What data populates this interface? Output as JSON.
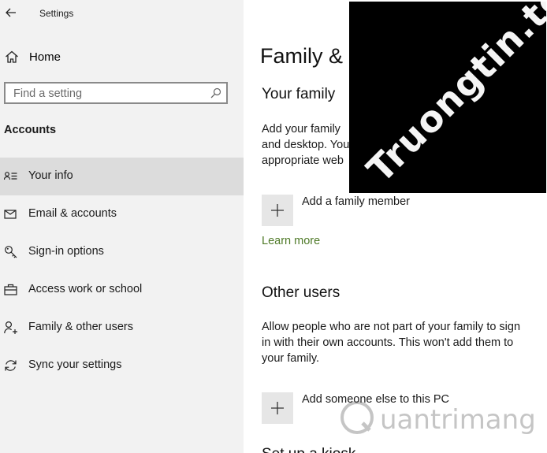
{
  "window": {
    "title": "Settings"
  },
  "sidebar": {
    "home_label": "Home",
    "search_placeholder": "Find a setting",
    "section_label": "Accounts",
    "items": [
      {
        "label": "Your info",
        "icon": "person-card-icon",
        "selected": true
      },
      {
        "label": "Email & accounts",
        "icon": "mail-icon",
        "selected": false
      },
      {
        "label": "Sign-in options",
        "icon": "key-icon",
        "selected": false
      },
      {
        "label": "Access work or school",
        "icon": "briefcase-icon",
        "selected": false
      },
      {
        "label": "Family & other users",
        "icon": "person-add-icon",
        "selected": false
      },
      {
        "label": "Sync your settings",
        "icon": "sync-icon",
        "selected": false
      }
    ]
  },
  "main": {
    "page_title": "Family & o",
    "your_family": {
      "heading": "Your family",
      "desc_line1": "Add your family",
      "desc_line2": "and desktop. You",
      "desc_line3": "appropriate web",
      "add_label": "Add a family member",
      "learn_more": "Learn more"
    },
    "other_users": {
      "heading": "Other users",
      "desc_line1": "Allow people who are not part of your family to sign",
      "desc_line2": "in with their own accounts. This won't add them to",
      "desc_line3": "your family.",
      "add_label": "Add someone else to this PC"
    },
    "cut_heading": "Set up a kiosk"
  },
  "watermarks": {
    "top": "Truongtin.top",
    "bottom": "uantrimang"
  },
  "colors": {
    "link": "#4f7a28",
    "sidebar_bg": "#f2f2f2",
    "selected_bg": "#dcdcdc"
  }
}
